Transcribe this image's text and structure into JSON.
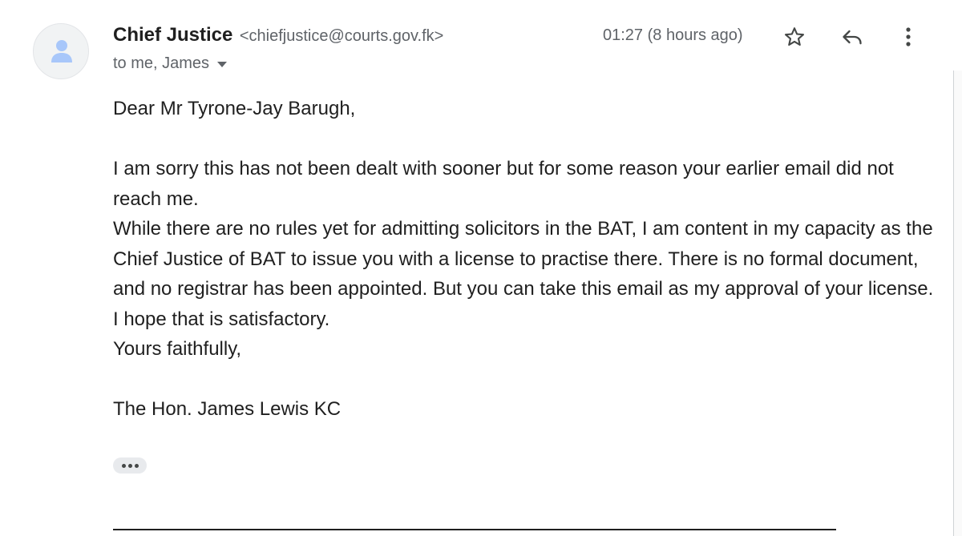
{
  "header": {
    "sender_name": "Chief Justice",
    "sender_email": "<chiefjustice@courts.gov.fk>",
    "recipients": "to me, James",
    "timestamp": "01:27 (8 hours ago)"
  },
  "icons": {
    "avatar": "person-icon",
    "star": "star-icon",
    "reply": "reply-icon",
    "more": "more-vert-icon",
    "recipients_toggle": "caret-down-icon",
    "trimmed_content": "ellipsis-icon"
  },
  "body": {
    "greeting": "Dear Mr Tyrone-Jay Barugh,",
    "lines": [
      "I am sorry this has not been dealt with sooner but for some reason your earlier email did not reach me.",
      "While there are no rules yet for admitting solicitors in the BAT, I am content in my capacity as the Chief Justice of BAT to issue you with a license to practise there. There is no formal document, and no registrar has been appointed. But you can take this email as my approval of your license.",
      "I hope that is satisfactory.",
      "Yours faithfully,"
    ],
    "signature": "The Hon. James Lewis KC"
  },
  "colors": {
    "text": "#1f1f1f",
    "muted": "#5f6368",
    "avatar_bg": "#f1f3f4",
    "avatar_icon": "#a8c7fa",
    "chip_bg": "#e8eaed"
  }
}
